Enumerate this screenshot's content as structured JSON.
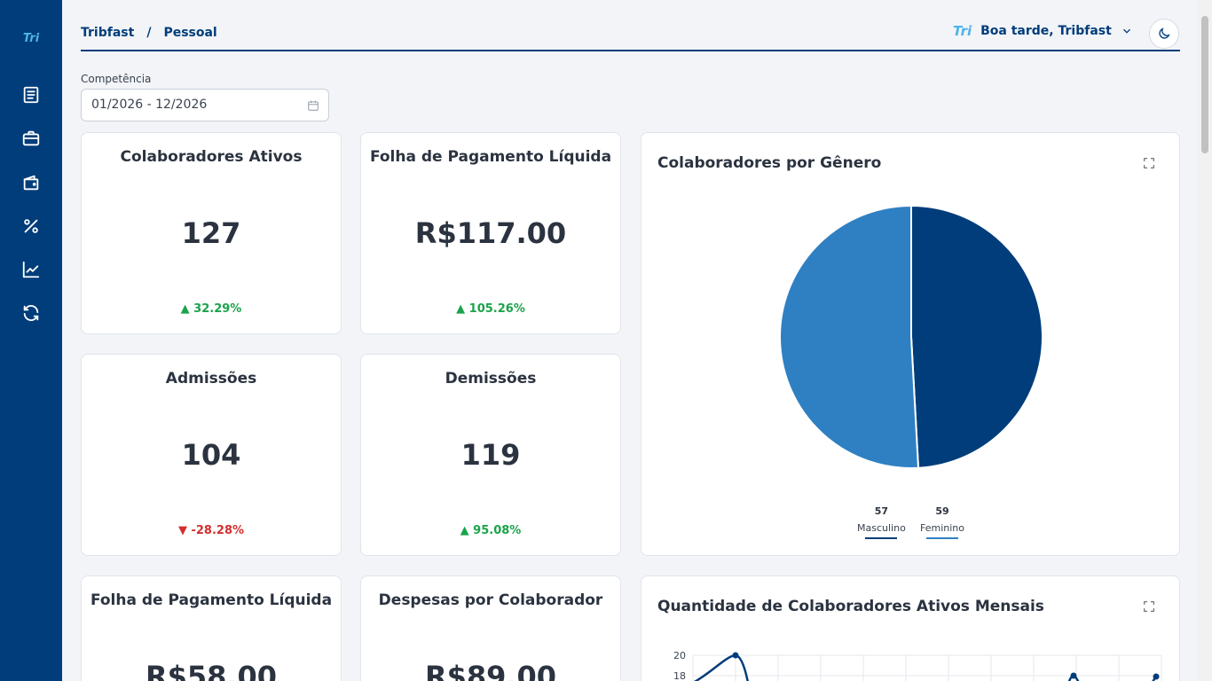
{
  "app": {
    "logo": "Tri"
  },
  "breadcrumb": {
    "root": "Tribfast",
    "separator": "/",
    "current": "Pessoal"
  },
  "user": {
    "brand": "Tri",
    "greeting": "Boa tarde, Tribfast"
  },
  "filter": {
    "label": "Competência",
    "value": "01/2026 - 12/2026"
  },
  "kpis": [
    {
      "title": "Colaboradores Ativos",
      "value": "127",
      "delta": "▲ 32.29%",
      "trend": "up"
    },
    {
      "title": "Folha de Pagamento Líquida",
      "value": "R$117.00",
      "delta": "▲ 105.26%",
      "trend": "up"
    },
    {
      "title": "Admissões",
      "value": "104",
      "delta": "▼ -28.28%",
      "trend": "down"
    },
    {
      "title": "Demissões",
      "value": "119",
      "delta": "▲ 95.08%",
      "trend": "up"
    },
    {
      "title": "Folha de Pagamento Líquida",
      "value": "R$58.00"
    },
    {
      "title": "Despesas por Colaborador",
      "value": "R$89.00"
    }
  ],
  "gender_chart": {
    "title": "Colaboradores por Gênero",
    "colors": {
      "masculino": "#003d7a",
      "feminino": "#2f80c3"
    },
    "chart_data": {
      "type": "pie",
      "slices": [
        {
          "label": "Masculino",
          "value": 57
        },
        {
          "label": "Feminino",
          "value": 59
        }
      ]
    },
    "legend": [
      {
        "count": "57",
        "name": "Masculino"
      },
      {
        "count": "59",
        "name": "Feminino"
      }
    ]
  },
  "monthly_chart": {
    "title": "Quantidade de Colaboradores Ativos Mensais",
    "y_ticks": [
      "20",
      "18"
    ]
  }
}
